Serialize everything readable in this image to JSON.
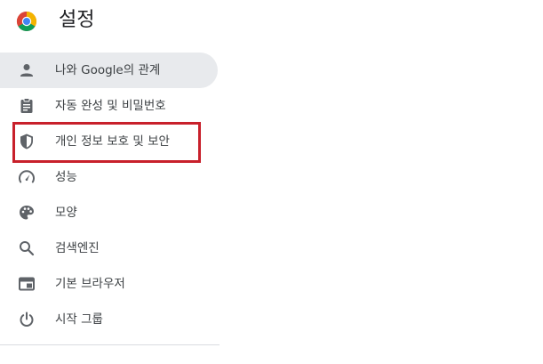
{
  "header": {
    "title": "설정"
  },
  "nav": {
    "items": [
      {
        "label": "나와 Google의 관계",
        "icon": "person-icon",
        "active": true
      },
      {
        "label": "자동 완성 및 비밀번호",
        "icon": "clipboard-icon",
        "active": false
      },
      {
        "label": "개인 정보 보호 및 보안",
        "icon": "shield-icon",
        "active": false
      },
      {
        "label": "성능",
        "icon": "speedometer-icon",
        "active": false
      },
      {
        "label": "모양",
        "icon": "palette-icon",
        "active": false
      },
      {
        "label": "검색엔진",
        "icon": "search-icon",
        "active": false
      },
      {
        "label": "기본 브라우저",
        "icon": "browser-window-icon",
        "active": false
      },
      {
        "label": "시작 그룹",
        "icon": "power-icon",
        "active": false
      }
    ]
  },
  "colors": {
    "active_background": "#e8eaed",
    "highlight_border": "#c8202b",
    "icon_color": "#5f6368",
    "text_color": "#3c4043"
  }
}
